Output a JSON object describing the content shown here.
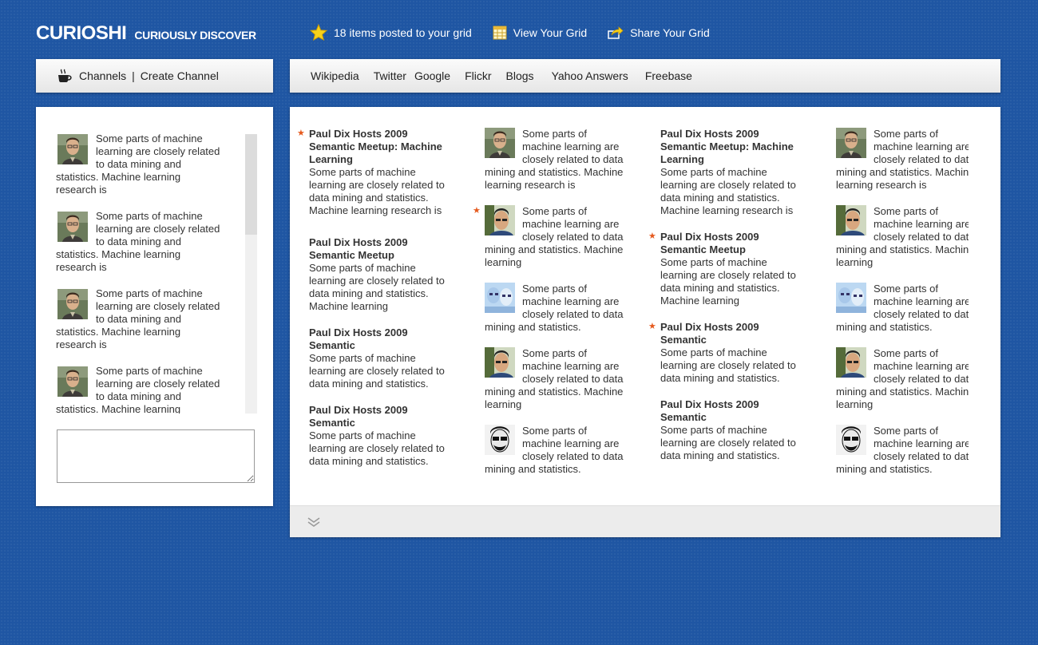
{
  "brand": {
    "name": "CURIOSHI",
    "tagline": "CURIOUSLY DISCOVER"
  },
  "topnav": {
    "posted": "18 items posted to your grid",
    "view": "View Your Grid",
    "share": "Share Your Grid"
  },
  "channels": {
    "channels_label": "Channels",
    "separator": "|",
    "create_label": "Create Channel"
  },
  "sources": [
    "Wikipedia",
    "Twitter",
    "Google",
    "Flickr",
    "Blogs",
    "Yahoo Answers",
    "Freebase"
  ],
  "chat": {
    "items": [
      "Some parts of machine learning are closely related to data mining and statistics. Machine learning research is",
      "Some parts of machine learning are closely related to data mining and statistics. Machine learning research is",
      "Some parts of machine learning are closely related to data mining and statistics. Machine learning research is",
      "Some parts of machine learning are closely related to data mining and statistics. Machine learning research is"
    ]
  },
  "grid": {
    "col1": [
      {
        "starred": true,
        "title": "Paul Dix Hosts 2009 Semantic Meetup: Machine Learning",
        "text": "Some parts of machine learning are closely related to data mining and statistics. Machine learning research is"
      },
      {
        "starred": false,
        "title": "Paul Dix Hosts 2009 Semantic Meetup",
        "text": "Some parts of machine learning are closely related to data mining and statistics. Machine learning"
      },
      {
        "starred": false,
        "title": "Paul Dix Hosts 2009 Semantic",
        "text": "Some parts of machine learning are closely related to data mining and statistics."
      },
      {
        "starred": false,
        "title": "Paul Dix Hosts 2009 Semantic",
        "text": "Some parts of machine learning are closely related to data mining and statistics."
      }
    ],
    "col2": [
      {
        "starred": false,
        "avatar": "a",
        "text": "Some parts of machine learning are closely related to data mining and statistics. Machine learning research is"
      },
      {
        "starred": true,
        "avatar": "b",
        "text": "Some parts of machine learning are closely related to data mining and statistics. Machine learning"
      },
      {
        "starred": false,
        "avatar": "c",
        "text": "Some parts of machine learning are closely related to data mining and statistics."
      },
      {
        "starred": false,
        "avatar": "b",
        "text": "Some parts of machine learning are closely related to data mining and statistics. Machine learning"
      },
      {
        "starred": false,
        "avatar": "d",
        "text": "Some parts of machine learning are closely related to data mining and statistics."
      }
    ],
    "col3": [
      {
        "starred": false,
        "title": "Paul Dix Hosts 2009 Semantic Meetup: Machine Learning",
        "text": "Some parts of machine learning are closely related to data mining and statistics. Machine learning research is"
      },
      {
        "starred": true,
        "title": "Paul Dix Hosts 2009 Semantic Meetup",
        "text": "Some parts of machine learning are closely related to data mining and statistics. Machine learning"
      },
      {
        "starred": true,
        "title": "Paul Dix Hosts 2009 Semantic",
        "text": "Some parts of machine learning are closely related to data mining and statistics."
      },
      {
        "starred": false,
        "title": "Paul Dix Hosts 2009 Semantic",
        "text": "Some parts of machine learning are closely related to data mining and statistics."
      }
    ],
    "col4": [
      {
        "starred": false,
        "avatar": "a",
        "text": "Some parts of machine learning are closely related to data mining and statistics. Machine learning research is"
      },
      {
        "starred": false,
        "avatar": "b",
        "text": "Some parts of machine learning are closely related to data mining and statistics. Machine learning"
      },
      {
        "starred": false,
        "avatar": "c",
        "text": "Some parts of machine learning are closely related to data mining and statistics."
      },
      {
        "starred": false,
        "avatar": "b",
        "text": "Some parts of machine learning are closely related to data mining and statistics. Machine learning"
      },
      {
        "starred": false,
        "avatar": "d",
        "text": "Some parts of machine learning are closely related to data mining and statistics."
      }
    ]
  },
  "colors": {
    "background": "#1f56a3",
    "star": "#e55a1e",
    "panel": "#ffffff"
  },
  "icons": {
    "posted": "star-icon",
    "view": "grid-icon",
    "share": "share-arrow-icon",
    "channels": "coffee-cup-icon",
    "footer": "double-chevron-down-icon"
  }
}
